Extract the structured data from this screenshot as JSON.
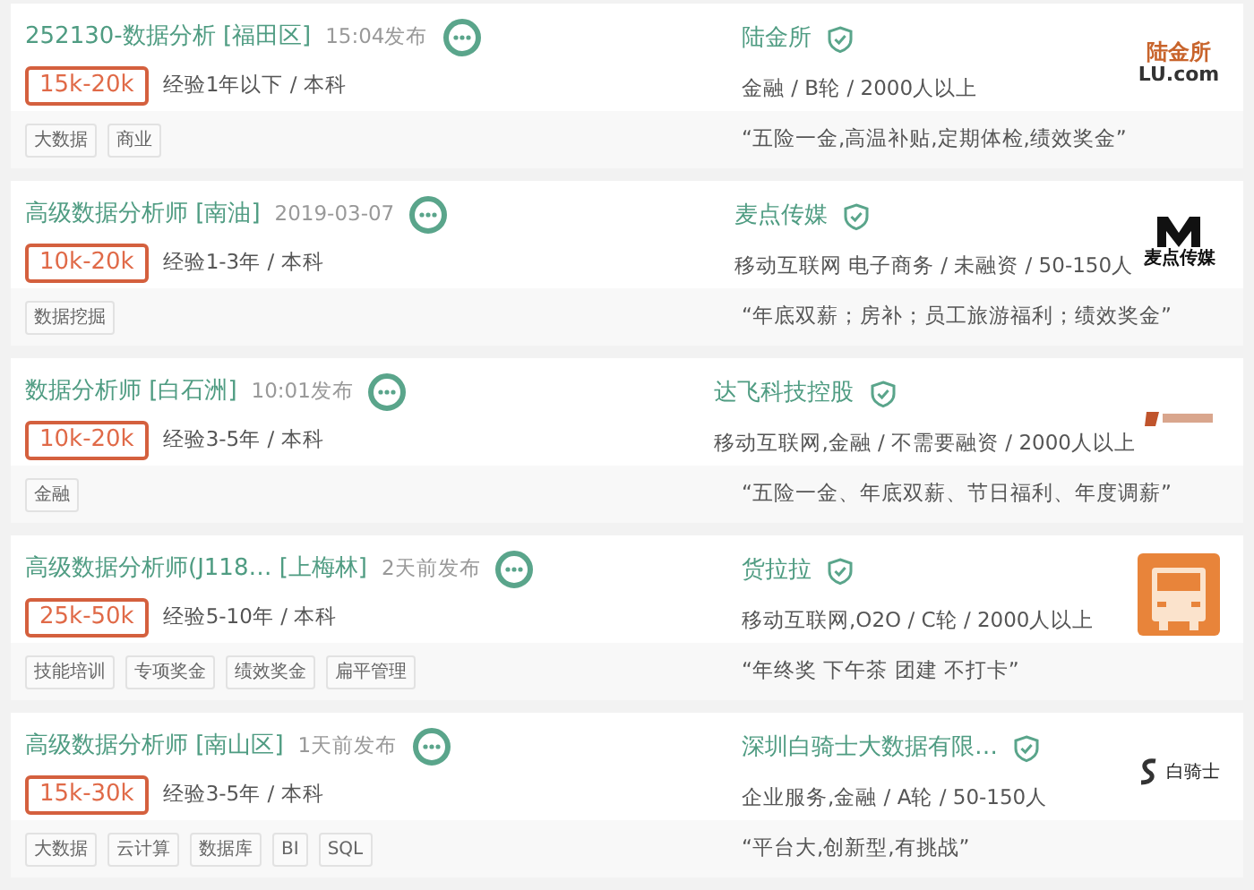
{
  "jobs": [
    {
      "title": "252130-数据分析 [福田区]",
      "posted": "15:04发布",
      "salary": "15k-20k",
      "requirements": "经验1年以下 / 本科",
      "company": "陆金所",
      "verified": true,
      "company_info": "金融 / B轮 / 2000人以上",
      "tags": [
        "大数据",
        "商业"
      ],
      "benefits": "“五险一金,高温补贴,定期体检,绩效奖金”",
      "logo": {
        "kind": "lu",
        "texts": [
          "陆金所",
          "LU.com"
        ]
      }
    },
    {
      "title": "高级数据分析师 [南油]",
      "posted": "2019-03-07",
      "salary": "10k-20k",
      "requirements": "经验1-3年 / 本科",
      "company": "麦点传媒",
      "verified": true,
      "company_info": "移动互联网 电子商务 / 未融资 / 50-150人",
      "tags": [
        "数据挖掘"
      ],
      "benefits": "“年底双薪；房补；员工旅游福利；绩效奖金”",
      "logo": {
        "kind": "maidian",
        "texts": [
          "麦点传媒"
        ]
      }
    },
    {
      "title": "数据分析师 [白石洲]",
      "posted": "10:01发布",
      "salary": "10k-20k",
      "requirements": "经验3-5年 / 本科",
      "company": "达飞科技控股",
      "verified": true,
      "company_info": "移动互联网,金融 / 不需要融资 / 2000人以上",
      "tags": [
        "金融"
      ],
      "benefits": "“五险一金、年底双薪、节日福利、年度调薪”",
      "logo": {
        "kind": "dafei"
      }
    },
    {
      "title": "高级数据分析师(J118… [上梅林]",
      "posted": "2天前发布",
      "salary": "25k-50k",
      "requirements": "经验5-10年 / 本科",
      "company": "货拉拉",
      "verified": true,
      "company_info": "移动互联网,O2O / C轮 / 2000人以上",
      "tags": [
        "技能培训",
        "专项奖金",
        "绩效奖金",
        "扁平管理"
      ],
      "benefits": "“年终奖 下午茶 团建 不打卡”",
      "logo": {
        "kind": "truck"
      }
    },
    {
      "title": "高级数据分析师 [南山区]",
      "posted": "1天前发布",
      "salary": "15k-30k",
      "requirements": "经验3-5年 / 本科",
      "company": "深圳白骑士大数据有限…",
      "verified": true,
      "company_info": "企业服务,金融 / A轮 / 50-150人",
      "tags": [
        "大数据",
        "云计算",
        "数据库",
        "BI",
        "SQL"
      ],
      "benefits": "“平台大,创新型,有挑战”",
      "logo": {
        "kind": "baiqishi",
        "texts": [
          "白骑士"
        ]
      }
    }
  ]
}
